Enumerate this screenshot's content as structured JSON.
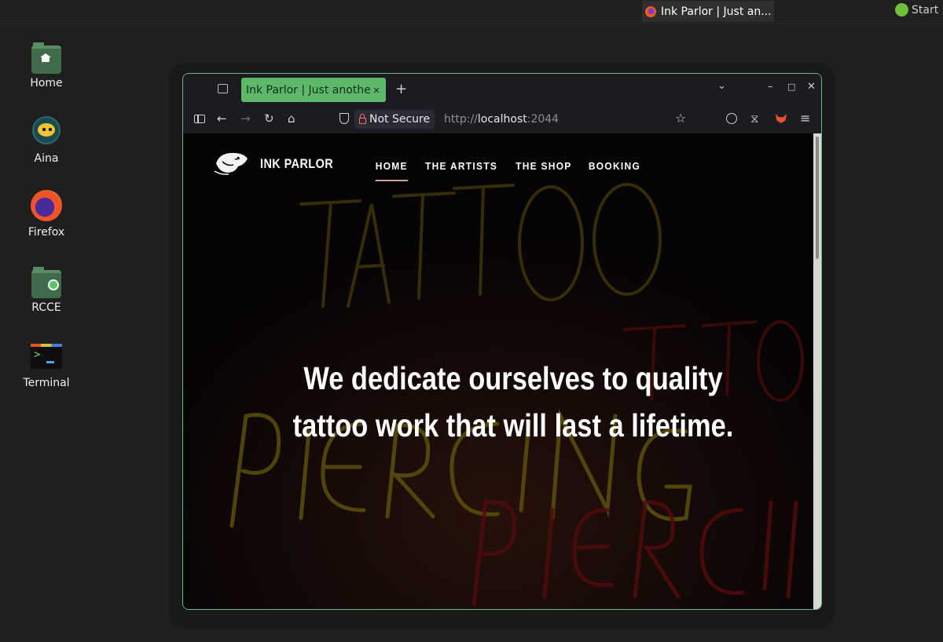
{
  "panel": {
    "task_title": "Ink Parlor | Just an...",
    "start_label": "Start"
  },
  "desktop": {
    "icons": [
      {
        "label": "Home",
        "icon": "home-folder-icon"
      },
      {
        "label": "Aina",
        "icon": "aina-icon"
      },
      {
        "label": "Firefox",
        "icon": "firefox-icon"
      },
      {
        "label": "RCCE",
        "icon": "rcce-folder-icon"
      },
      {
        "label": "Terminal",
        "icon": "terminal-icon"
      }
    ]
  },
  "browser": {
    "tab_title": "Ink Parlor | Just another",
    "tab_close": "×",
    "new_tab": "+",
    "not_secure": "Not Secure",
    "url_scheme": "http://",
    "url_host": "localhost",
    "url_port": ":2044"
  },
  "site": {
    "brand": "INK PARLOR",
    "nav": [
      "HOME",
      "THE ARTISTS",
      "THE SHOP",
      "BOOKING"
    ],
    "active_nav": "HOME",
    "hero_line1": "We dedicate ourselves to quality",
    "hero_line2": "tattoo work that will last a lifetime."
  },
  "colors": {
    "accent_green": "#5db86a",
    "window_border": "#6fb38a",
    "nav_underline": "#c8a883"
  }
}
